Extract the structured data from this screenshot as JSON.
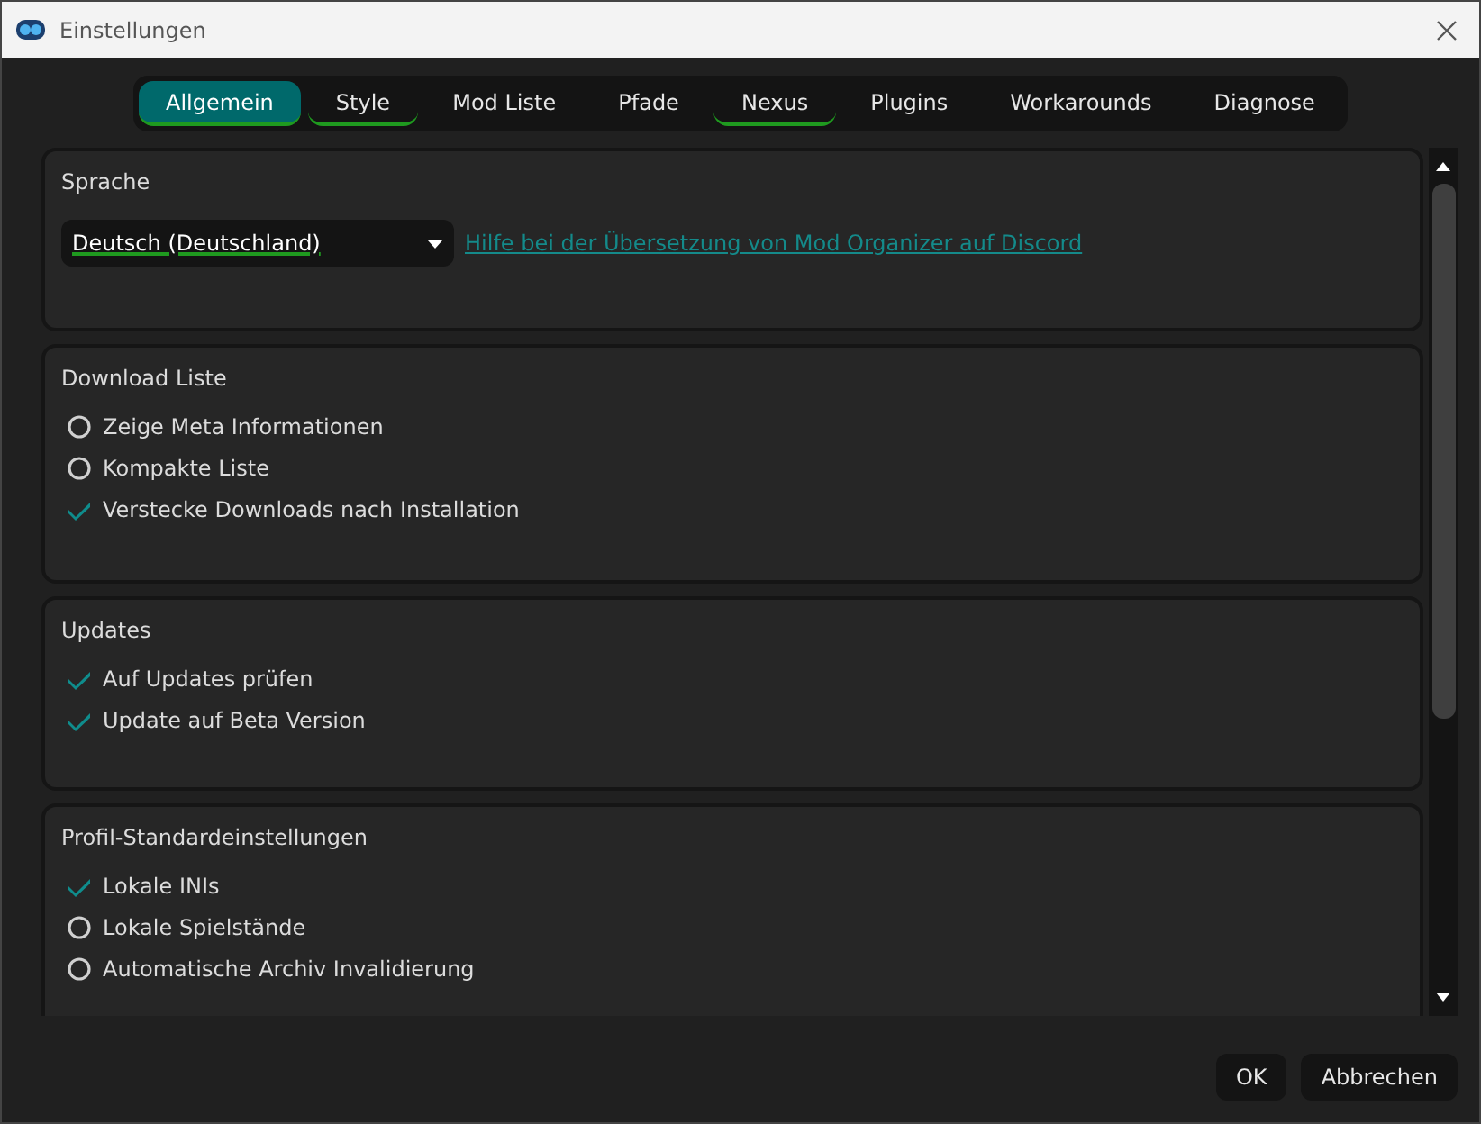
{
  "window": {
    "title": "Einstellungen"
  },
  "tabs": [
    {
      "label": "Allgemein",
      "selected": true,
      "underlined": true
    },
    {
      "label": "Style",
      "selected": false,
      "underlined": true
    },
    {
      "label": "Mod Liste",
      "selected": false,
      "underlined": false
    },
    {
      "label": "Pfade",
      "selected": false,
      "underlined": false
    },
    {
      "label": "Nexus",
      "selected": false,
      "underlined": true
    },
    {
      "label": "Plugins",
      "selected": false,
      "underlined": false
    },
    {
      "label": "Workarounds",
      "selected": false,
      "underlined": false
    },
    {
      "label": "Diagnose",
      "selected": false,
      "underlined": false
    }
  ],
  "language": {
    "title": "Sprache",
    "value": "Deutsch (Deutschland)",
    "underlined": true,
    "link": "Hilfe bei der Übersetzung von Mod Organizer auf Discord"
  },
  "groups": [
    {
      "title": "Download Liste",
      "options": [
        {
          "label": "Zeige Meta Informationen",
          "checked": false
        },
        {
          "label": "Kompakte Liste",
          "checked": false
        },
        {
          "label": "Verstecke Downloads nach Installation",
          "checked": true
        }
      ]
    },
    {
      "title": "Updates",
      "options": [
        {
          "label": "Auf Updates prüfen",
          "checked": true
        },
        {
          "label": "Update auf Beta Version",
          "checked": true
        }
      ]
    },
    {
      "title": "Profil-Standardeinstellungen",
      "options": [
        {
          "label": "Lokale INIs",
          "checked": true
        },
        {
          "label": "Lokale Spielstände",
          "checked": false
        },
        {
          "label": "Automatische Archiv Invalidierung",
          "checked": false
        }
      ]
    }
  ],
  "buttons": [
    "OK",
    "Abbrechen"
  ]
}
